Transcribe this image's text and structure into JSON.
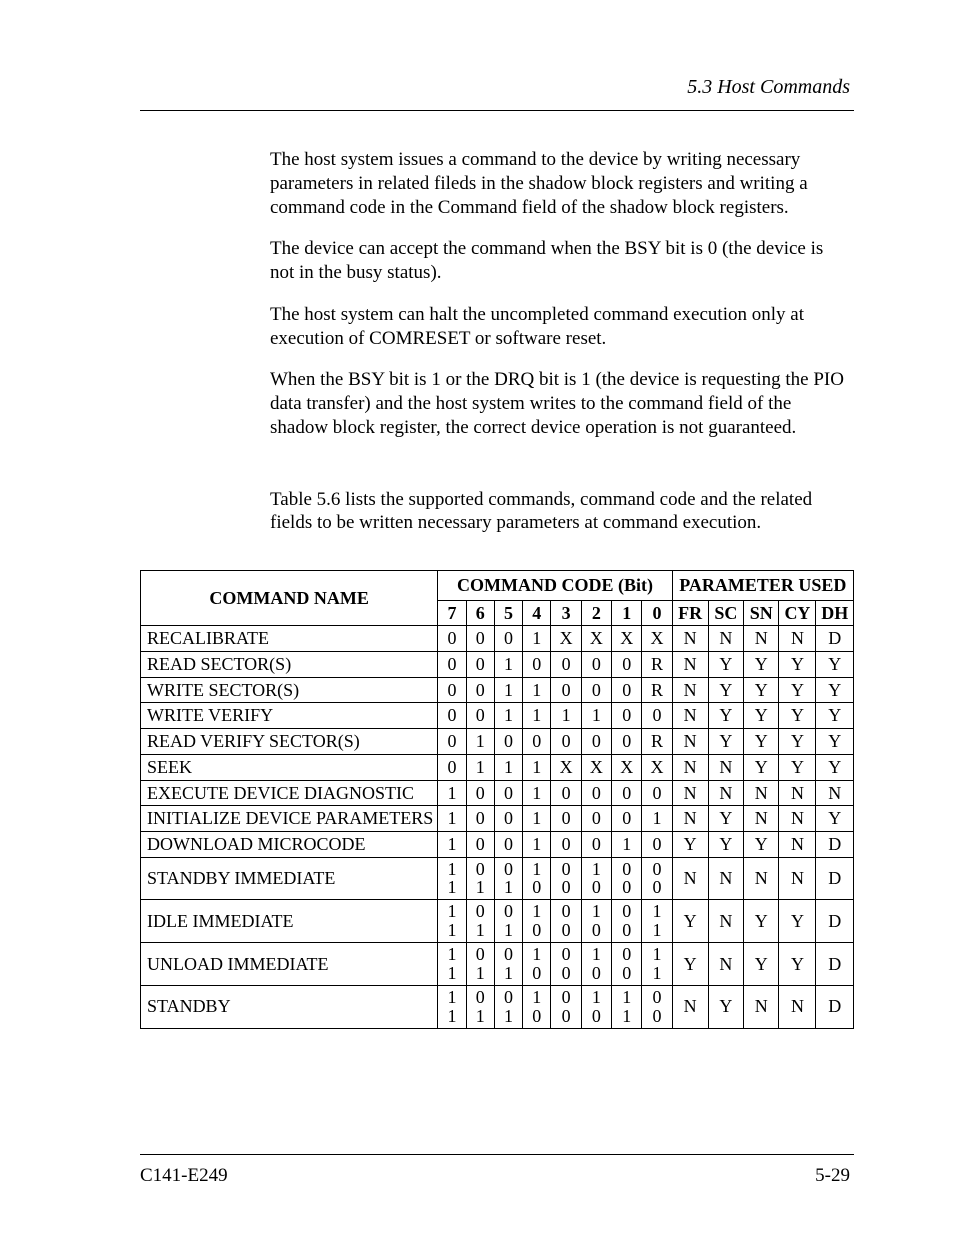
{
  "header": {
    "section": "5.3  Host Commands"
  },
  "paragraphs": {
    "p1": "The host system issues a command to the device by writing necessary parameters in related fileds in the shadow block registers and writing a command code in the Command field of the shadow block registers.",
    "p2": "The device can accept the command when the BSY bit is 0 (the device is not in the busy status).",
    "p3": "The host system can halt the uncompleted command execution only at execution of COMRESET or software reset.",
    "p4": "When the BSY bit is 1 or the DRQ bit is 1 (the device is requesting the PIO data transfer) and the host system writes to the command field of the shadow block register, the correct device operation is not guaranteed.",
    "p5": "Table 5.6 lists the supported commands, command code and the related fields to be written necessary parameters at command execution."
  },
  "table": {
    "headers": {
      "name": "COMMAND NAME",
      "code_group": "COMMAND CODE (Bit)",
      "param_group": "PARAMETER USED",
      "bits": [
        "7",
        "6",
        "5",
        "4",
        "3",
        "2",
        "1",
        "0"
      ],
      "params": [
        "FR",
        "SC",
        "SN",
        "CY",
        "DH"
      ]
    },
    "rows": [
      {
        "name": "RECALIBRATE",
        "bits": [
          "0",
          "0",
          "0",
          "1",
          "X",
          "X",
          "X",
          "X"
        ],
        "params": [
          "N",
          "N",
          "N",
          "N",
          "D"
        ]
      },
      {
        "name": "READ SECTOR(S)",
        "bits": [
          "0",
          "0",
          "1",
          "0",
          "0",
          "0",
          "0",
          "R"
        ],
        "params": [
          "N",
          "Y",
          "Y",
          "Y",
          "Y"
        ]
      },
      {
        "name": "WRITE SECTOR(S)",
        "bits": [
          "0",
          "0",
          "1",
          "1",
          "0",
          "0",
          "0",
          "R"
        ],
        "params": [
          "N",
          "Y",
          "Y",
          "Y",
          "Y"
        ]
      },
      {
        "name": "WRITE VERIFY",
        "bits": [
          "0",
          "0",
          "1",
          "1",
          "1",
          "1",
          "0",
          "0"
        ],
        "params": [
          "N",
          "Y",
          "Y",
          "Y",
          "Y"
        ]
      },
      {
        "name": "READ VERIFY SECTOR(S)",
        "bits": [
          "0",
          "1",
          "0",
          "0",
          "0",
          "0",
          "0",
          "R"
        ],
        "params": [
          "N",
          "Y",
          "Y",
          "Y",
          "Y"
        ]
      },
      {
        "name": "SEEK",
        "bits": [
          "0",
          "1",
          "1",
          "1",
          "X",
          "X",
          "X",
          "X"
        ],
        "params": [
          "N",
          "N",
          "Y",
          "Y",
          "Y"
        ]
      },
      {
        "name": "EXECUTE DEVICE DIAGNOSTIC",
        "bits": [
          "1",
          "0",
          "0",
          "1",
          "0",
          "0",
          "0",
          "0"
        ],
        "params": [
          "N",
          "N",
          "N",
          "N",
          "N"
        ]
      },
      {
        "name": "INITIALIZE DEVICE PARAMETERS",
        "bits": [
          "1",
          "0",
          "0",
          "1",
          "0",
          "0",
          "0",
          "1"
        ],
        "params": [
          "N",
          "Y",
          "N",
          "N",
          "Y"
        ]
      },
      {
        "name": "DOWNLOAD MICROCODE",
        "bits": [
          "1",
          "0",
          "0",
          "1",
          "0",
          "0",
          "1",
          "0"
        ],
        "params": [
          "Y",
          "Y",
          "Y",
          "N",
          "D"
        ]
      },
      {
        "name": "STANDBY IMMEDIATE",
        "bits": [
          [
            "1",
            "1"
          ],
          [
            "0",
            "1"
          ],
          [
            "0",
            "1"
          ],
          [
            "1",
            "0"
          ],
          [
            "0",
            "0"
          ],
          [
            "1",
            "0"
          ],
          [
            "0",
            "0"
          ],
          [
            "0",
            "0"
          ]
        ],
        "params": [
          "N",
          "N",
          "N",
          "N",
          "D"
        ]
      },
      {
        "name": "IDLE IMMEDIATE",
        "bits": [
          [
            "1",
            "1"
          ],
          [
            "0",
            "1"
          ],
          [
            "0",
            "1"
          ],
          [
            "1",
            "0"
          ],
          [
            "0",
            "0"
          ],
          [
            "1",
            "0"
          ],
          [
            "0",
            "0"
          ],
          [
            "1",
            "1"
          ]
        ],
        "params": [
          "Y",
          "N",
          "Y",
          "Y",
          "D"
        ]
      },
      {
        "name": "UNLOAD IMMEDIATE",
        "bits": [
          [
            "1",
            "1"
          ],
          [
            "0",
            "1"
          ],
          [
            "0",
            "1"
          ],
          [
            "1",
            "0"
          ],
          [
            "0",
            "0"
          ],
          [
            "1",
            "0"
          ],
          [
            "0",
            "0"
          ],
          [
            "1",
            "1"
          ]
        ],
        "params": [
          "Y",
          "N",
          "Y",
          "Y",
          "D"
        ]
      },
      {
        "name": "STANDBY",
        "bits": [
          [
            "1",
            "1"
          ],
          [
            "0",
            "1"
          ],
          [
            "0",
            "1"
          ],
          [
            "1",
            "0"
          ],
          [
            "0",
            "0"
          ],
          [
            "1",
            "0"
          ],
          [
            "1",
            "1"
          ],
          [
            "0",
            "0"
          ]
        ],
        "params": [
          "N",
          "Y",
          "N",
          "N",
          "D"
        ]
      }
    ]
  },
  "footer": {
    "left": "C141-E249",
    "right": "5-29"
  }
}
